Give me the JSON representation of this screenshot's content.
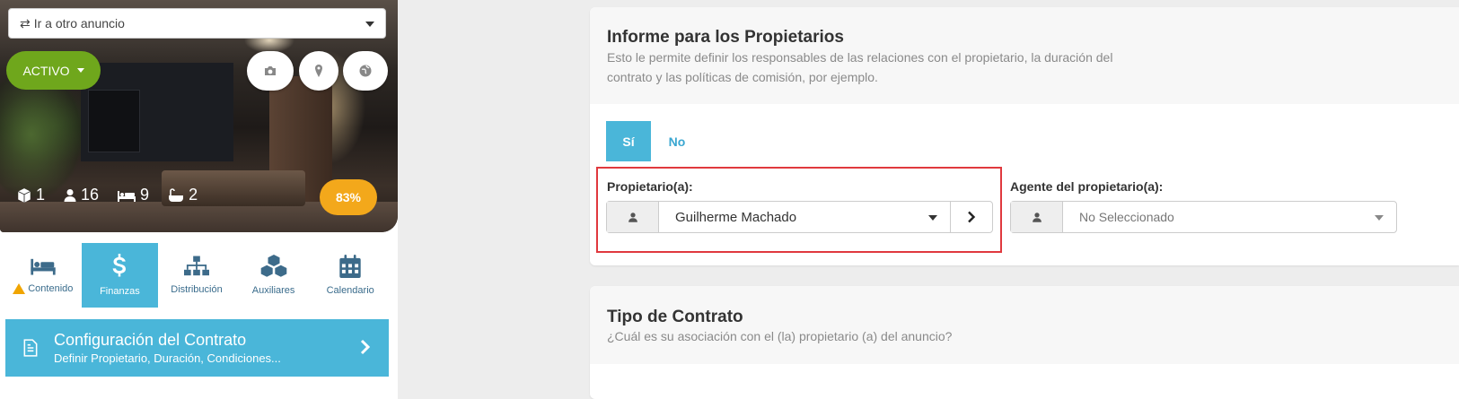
{
  "listing": {
    "go_to_other_ad": "Ir a otro anuncio",
    "status": "ACTIVO",
    "stats": {
      "units": "1",
      "guests": "16",
      "beds": "9",
      "baths": "2"
    },
    "completeness": "83%"
  },
  "tabs": [
    {
      "label": "Contenido",
      "icon": "bed-icon",
      "warning": true
    },
    {
      "label": "Finanzas",
      "icon": "dollar-icon",
      "active": true
    },
    {
      "label": "Distribución",
      "icon": "sitemap-icon"
    },
    {
      "label": "Auxiliares",
      "icon": "cubes-icon"
    },
    {
      "label": "Calendario",
      "icon": "calendar-icon"
    }
  ],
  "contract_card": {
    "title": "Configuración del Contrato",
    "subtitle": "Definir Propietario, Duración, Condiciones..."
  },
  "owners_report": {
    "title": "Informe para los Propietarios",
    "description": "Esto le permite definir los responsables de las relaciones con el propietario, la duración del contrato y las políticas de comisión, por ejemplo.",
    "yes_label": "Sí",
    "no_label": "No",
    "owner_label": "Propietario(a):",
    "owner_value": "Guilherme Machado",
    "agent_label": "Agente del propietario(a):",
    "agent_value": "No Seleccionado"
  },
  "contract_type": {
    "title": "Tipo de Contrato",
    "description": "¿Cuál es su asociación con el (la) propietario (a) del anuncio?"
  },
  "colors": {
    "accent": "#4ab6d9",
    "status_green": "#6fa71c",
    "completeness_orange": "#f3a81b",
    "highlight_red": "#e0393e"
  }
}
